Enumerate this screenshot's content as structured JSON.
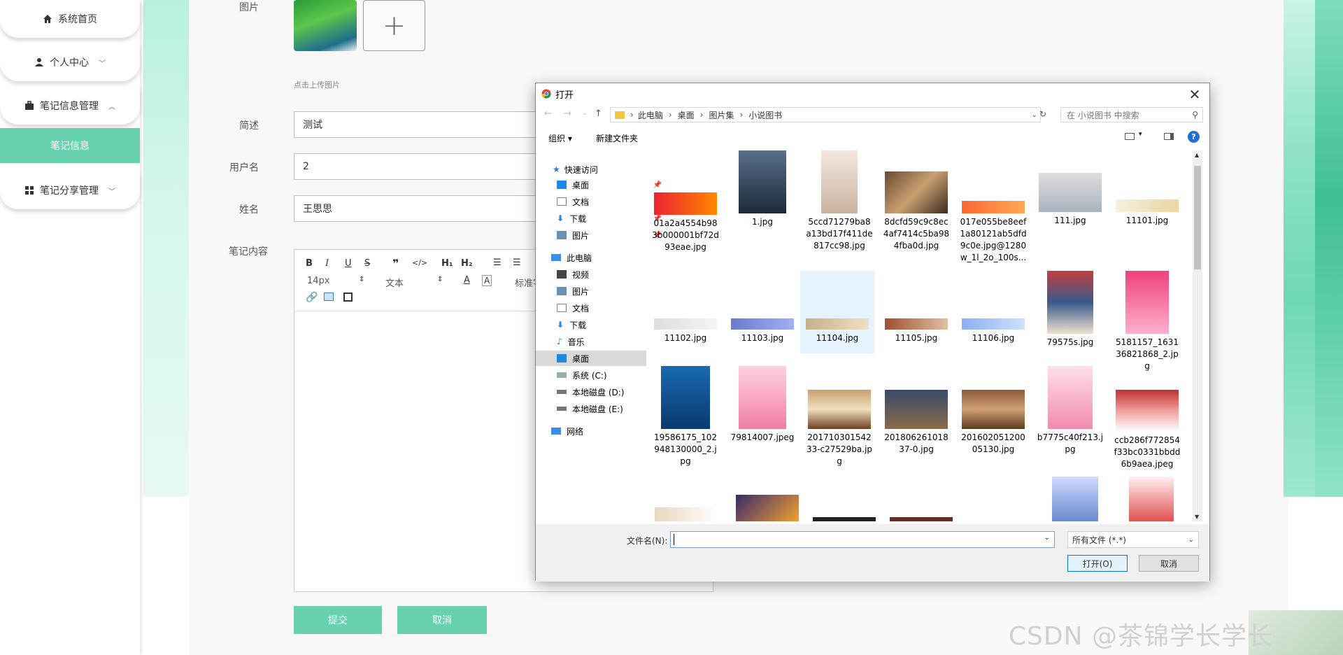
{
  "sidebar": {
    "items": [
      {
        "label": "系统首页"
      },
      {
        "label": "个人中心"
      },
      {
        "label": "笔记信息管理"
      },
      {
        "label": "笔记信息"
      },
      {
        "label": "笔记分享管理"
      }
    ]
  },
  "form": {
    "image_label": "图片",
    "upload_hint": "点击上传图片",
    "summary_label": "简述",
    "summary_value": "测试",
    "username_label": "用户名",
    "username_value": "2",
    "name_label": "姓名",
    "name_value": "王思思",
    "content_label": "笔记内容",
    "editor": {
      "font_size": "14px",
      "block_format": "文本",
      "font_family": "标准字"
    },
    "submit_label": "提交",
    "cancel_label": "取消"
  },
  "dialog": {
    "title": "打开",
    "breadcrumb": [
      "此电脑",
      "桌面",
      "图片集",
      "小说图书"
    ],
    "search_placeholder": "在 小说图书 中搜索",
    "organize_label": "组织 ▾",
    "new_folder_label": "新建文件夹",
    "nav": {
      "quick_access": "快速访问",
      "quick_items": [
        "桌面",
        "文档",
        "下载",
        "图片"
      ],
      "this_pc": "此电脑",
      "pc_items": [
        "视频",
        "图片",
        "文档",
        "下载",
        "音乐",
        "桌面",
        "系统 (C:)",
        "本地磁盘 (D:)",
        "本地磁盘 (E:)"
      ],
      "network": "网络"
    },
    "files": [
      {
        "name": "01a2a4554b983b000001bf72d93eae.jpg"
      },
      {
        "name": "1.jpg"
      },
      {
        "name": "5ccd71279ba8a13bd17f411de817cc98.jpg"
      },
      {
        "name": "8dcfd59c9c8ec4af7414c5ba984fba0d.jpg"
      },
      {
        "name": "017e055be8eef1a80121ab5dfd9c0e.jpg@1280w_1l_2o_100s..."
      },
      {
        "name": "111.jpg"
      },
      {
        "name": "11101.jpg"
      },
      {
        "name": "11102.jpg"
      },
      {
        "name": "11103.jpg"
      },
      {
        "name": "11104.jpg"
      },
      {
        "name": "11105.jpg"
      },
      {
        "name": "11106.jpg"
      },
      {
        "name": "79575s.jpg"
      },
      {
        "name": "5181157_163136821868_2.jpg"
      },
      {
        "name": "19586175_102948130000_2.jpg"
      },
      {
        "name": "79814007.jpeg"
      },
      {
        "name": "20171030154233-c27529ba.jpg"
      },
      {
        "name": "20180626101837-0.jpg"
      },
      {
        "name": "20160205120005130.jpg"
      },
      {
        "name": "b7775c40f213.jpg"
      },
      {
        "name": "ccb286f772854f33bc0331bbdd6b9aea.jpeg"
      }
    ],
    "filename_label": "文件名(N):",
    "filename_value": "",
    "filetype_value": "所有文件 (*.*)",
    "open_label": "打开(O)",
    "cancel_label": "取消"
  },
  "watermark": "CSDN @茶锦学长学长",
  "colors": {
    "accent": "#68d2b0",
    "selection": "#cce8ff"
  }
}
